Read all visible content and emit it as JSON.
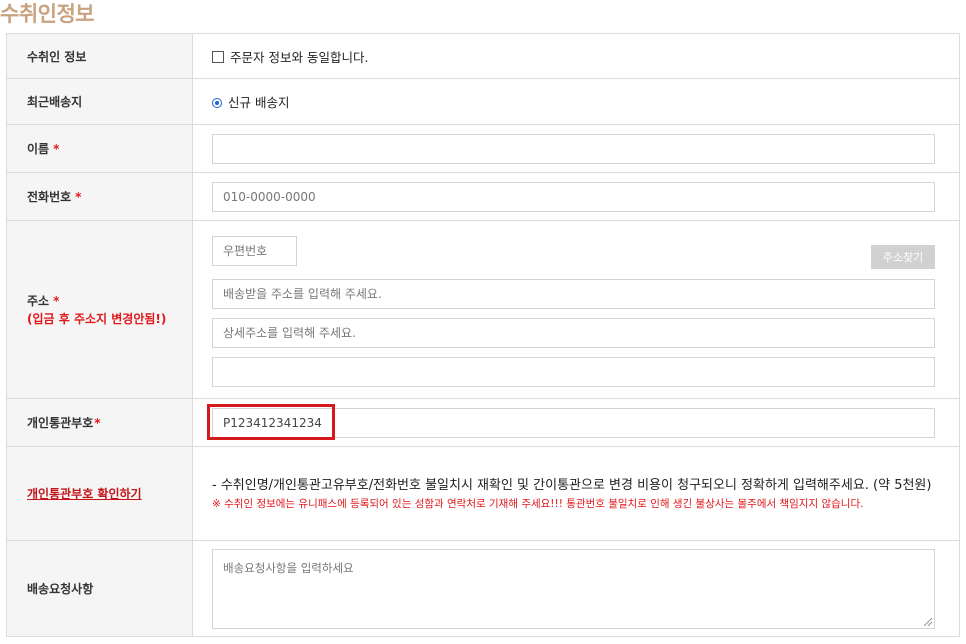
{
  "title": "수취인정보",
  "rows": {
    "recipient_info": {
      "label": "수취인 정보",
      "checkbox_label": "주문자 정보와 동일합니다."
    },
    "recent_shipping": {
      "label": "최근배송지",
      "radio_label": "신규 배송지"
    },
    "name": {
      "label": "이름",
      "required_mark": "*",
      "value": ""
    },
    "phone": {
      "label": "전화번호",
      "required_mark": "*",
      "placeholder": "010-0000-0000"
    },
    "address": {
      "label": "주소",
      "required_mark": "*",
      "note": "(입금 후 주소지 변경안됨!)",
      "zip_placeholder": "우편번호",
      "search_button": "주소찾기",
      "address1_placeholder": "배송받을 주소를 입력해 주세요.",
      "address2_placeholder": "상세주소를 입력해 주세요.",
      "address3_value": ""
    },
    "customs": {
      "label": "개인통관부호",
      "required_mark": "*",
      "value": "P123412341234"
    },
    "customs_check": {
      "link_label": "개인통관부호 확인하기",
      "notice": "- 수취인명/개인통관고유부호/전화번호 불일치시 재확인 및 간이통관으로 변경 비용이 청구되오니 정확하게 입력해주세요. (약 5천원)",
      "warning": "※ 수취인 정보에는 유니패스에 등록되어 있는 성함과 연락처로 기재해 주세요!!! 통관번호 불일치로 인해 생긴 불상사는 몰주에서 책임지지 않습니다."
    },
    "delivery_request": {
      "label": "배송요청사항",
      "placeholder": "배송요청사항을 입력하세요"
    }
  },
  "colors": {
    "title": "#c9a27f",
    "required": "#e0171b",
    "highlight": "#d6191d",
    "header_bg": "#f5f5f5",
    "button_bg": "#d1d1d1"
  }
}
